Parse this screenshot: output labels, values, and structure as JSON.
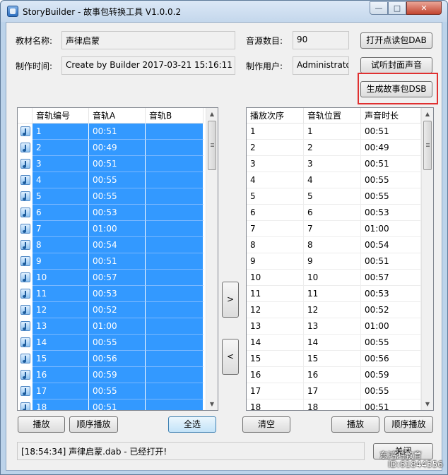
{
  "window": {
    "title": "StoryBuilder - 故事包转换工具 V1.0.0.2",
    "minimize_glyph": "—",
    "maximize_glyph": "□",
    "close_glyph": "✕"
  },
  "form": {
    "material_name_label": "教材名称:",
    "material_name_value": "声律启蒙",
    "create_time_label": "制作时间:",
    "create_time_value": "Create by Builder 2017-03-21 15:16:11",
    "source_count_label": "音源数目:",
    "source_count_value": "90",
    "maker_label": "制作用户:",
    "maker_value": "Administrator"
  },
  "buttons": {
    "open_dab": "打开点读包DAB",
    "preview_cover": "试听封面声音",
    "build_dsb": "生成故事包DSB",
    "move_right": ">",
    "move_left": "<",
    "left_play": "播放",
    "left_seq_play": "顺序播放",
    "select_all": "全选",
    "clear": "清空",
    "right_play": "播放",
    "right_seq_play": "顺序播放",
    "close": "关闭"
  },
  "left_table": {
    "columns": [
      "音轨编号",
      "音轨A",
      "音轨B"
    ],
    "rows": [
      {
        "id": "1",
        "a": "00:51",
        "b": ""
      },
      {
        "id": "2",
        "a": "00:49",
        "b": ""
      },
      {
        "id": "3",
        "a": "00:51",
        "b": ""
      },
      {
        "id": "4",
        "a": "00:55",
        "b": ""
      },
      {
        "id": "5",
        "a": "00:55",
        "b": ""
      },
      {
        "id": "6",
        "a": "00:53",
        "b": ""
      },
      {
        "id": "7",
        "a": "01:00",
        "b": ""
      },
      {
        "id": "8",
        "a": "00:54",
        "b": ""
      },
      {
        "id": "9",
        "a": "00:51",
        "b": ""
      },
      {
        "id": "10",
        "a": "00:57",
        "b": ""
      },
      {
        "id": "11",
        "a": "00:53",
        "b": ""
      },
      {
        "id": "12",
        "a": "00:52",
        "b": ""
      },
      {
        "id": "13",
        "a": "01:00",
        "b": ""
      },
      {
        "id": "14",
        "a": "00:55",
        "b": ""
      },
      {
        "id": "15",
        "a": "00:56",
        "b": ""
      },
      {
        "id": "16",
        "a": "00:59",
        "b": ""
      },
      {
        "id": "17",
        "a": "00:55",
        "b": ""
      },
      {
        "id": "18",
        "a": "00:51",
        "b": ""
      }
    ]
  },
  "right_table": {
    "columns": [
      "播放次序",
      "音轨位置",
      "声音时长"
    ],
    "rows": [
      {
        "order": "1",
        "pos": "1",
        "dur": "00:51"
      },
      {
        "order": "2",
        "pos": "2",
        "dur": "00:49"
      },
      {
        "order": "3",
        "pos": "3",
        "dur": "00:51"
      },
      {
        "order": "4",
        "pos": "4",
        "dur": "00:55"
      },
      {
        "order": "5",
        "pos": "5",
        "dur": "00:55"
      },
      {
        "order": "6",
        "pos": "6",
        "dur": "00:53"
      },
      {
        "order": "7",
        "pos": "7",
        "dur": "01:00"
      },
      {
        "order": "8",
        "pos": "8",
        "dur": "00:54"
      },
      {
        "order": "9",
        "pos": "9",
        "dur": "00:51"
      },
      {
        "order": "10",
        "pos": "10",
        "dur": "00:57"
      },
      {
        "order": "11",
        "pos": "11",
        "dur": "00:53"
      },
      {
        "order": "12",
        "pos": "12",
        "dur": "00:52"
      },
      {
        "order": "13",
        "pos": "13",
        "dur": "01:00"
      },
      {
        "order": "14",
        "pos": "14",
        "dur": "00:55"
      },
      {
        "order": "15",
        "pos": "15",
        "dur": "00:56"
      },
      {
        "order": "16",
        "pos": "16",
        "dur": "00:59"
      },
      {
        "order": "17",
        "pos": "17",
        "dur": "00:55"
      },
      {
        "order": "18",
        "pos": "18",
        "dur": "00:51"
      }
    ]
  },
  "status": {
    "message": "[18:54:34] 声律启蒙.dab - 已经打开!"
  },
  "watermark": {
    "line1": "东鸿鸿教育",
    "line2": "ID:61844556"
  },
  "colors": {
    "selection": "#3399ff",
    "highlight_border": "#e03030"
  }
}
